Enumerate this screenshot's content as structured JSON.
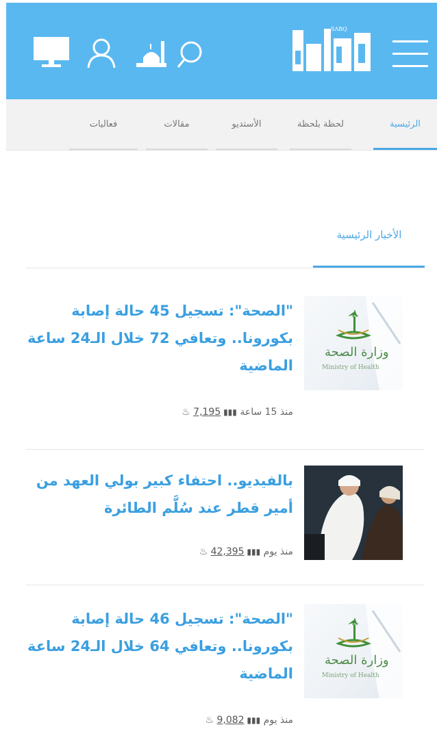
{
  "header": {
    "logo_text": "SABQ",
    "brand_color": "#5ab8f0",
    "icons": [
      "menu-icon",
      "search-icon",
      "mosque-icon",
      "user-icon",
      "monitor-icon"
    ]
  },
  "nav": {
    "tabs": [
      {
        "label": "الرئيسية",
        "active": true
      },
      {
        "label": "لحظة بلحظة",
        "active": false
      },
      {
        "label": "الأستديو",
        "active": false
      },
      {
        "label": "مقالات",
        "active": false
      },
      {
        "label": "فعاليات",
        "active": false
      }
    ]
  },
  "section": {
    "title": "الأخبار الرئيسية"
  },
  "articles": [
    {
      "headline": "\"الصحة\": تسجيل 45 حالة إصابة بكورونا.. وتعافي 72 خلال الـ24 ساعة الماضية",
      "time": "منذ 15 ساعة",
      "views": "7,195",
      "thumb_caption": "وزارة الصحة",
      "thumb_sub": "Ministry of Health"
    },
    {
      "headline": "بالفيديو.. احتفاء كبير بولي العهد من أمير قطر عند سُلَّم الطائرة",
      "time": "منذ يوم",
      "views": "42,395"
    },
    {
      "headline": "\"الصحة\": تسجيل 46 حالة إصابة بكورونا.. وتعافي 64 خلال الـ24 ساعة الماضية",
      "time": "منذ يوم",
      "views": "9,082",
      "thumb_caption": "وزارة الصحة",
      "thumb_sub": "Ministry of Health"
    }
  ]
}
